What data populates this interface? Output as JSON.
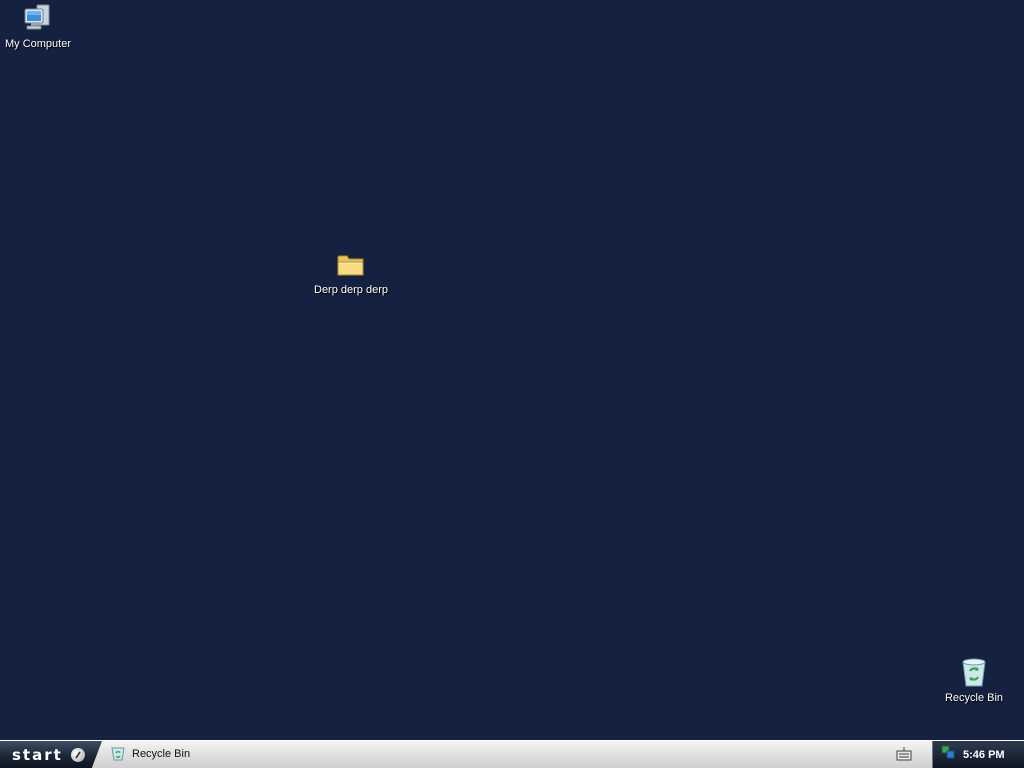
{
  "desktop": {
    "background": "#142140",
    "icons": [
      {
        "label": "My Computer",
        "icon": "computer-icon"
      },
      {
        "label": "Derp derp derp",
        "icon": "folder-icon"
      },
      {
        "label": "Recycle Bin",
        "icon": "recycle-bin-icon"
      }
    ]
  },
  "taskbar": {
    "start_label": "start",
    "tasks": [
      {
        "label": "Recycle Bin",
        "icon": "recycle-bin-icon"
      }
    ],
    "tray": {
      "icons": [
        "keyboard-icon",
        "network-icon"
      ],
      "clock": "5:46 PM"
    }
  }
}
